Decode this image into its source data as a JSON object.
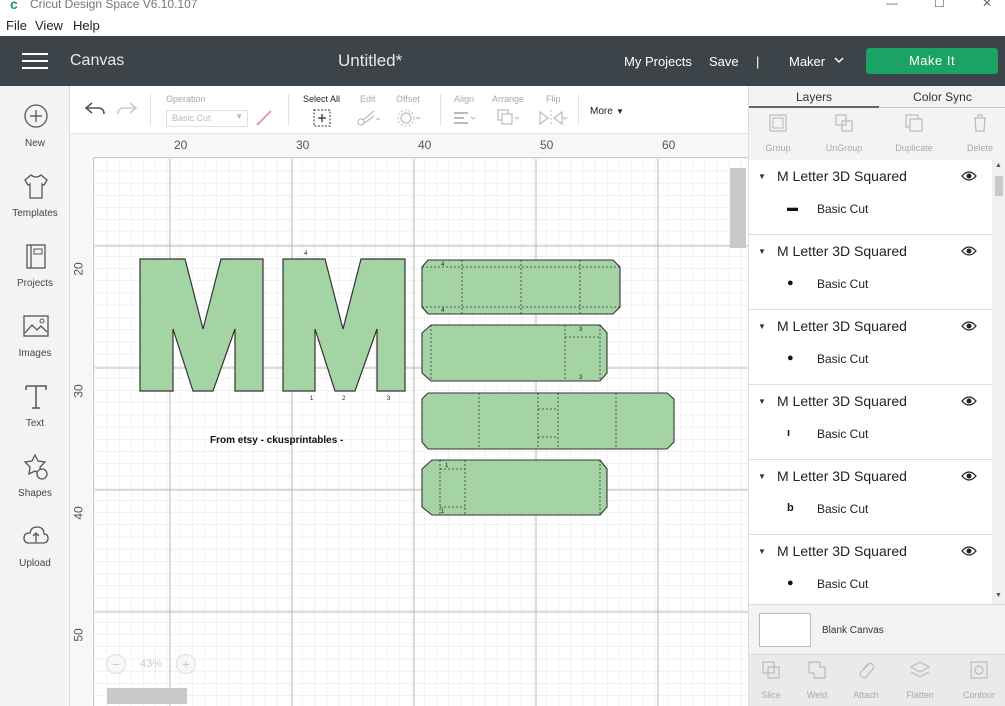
{
  "window": {
    "app_title": "Cricut Design Space  V6.10.107",
    "app_icon_glyph": "c"
  },
  "menu": {
    "items": [
      "File",
      "View",
      "Help"
    ]
  },
  "header": {
    "section": "Canvas",
    "doc_title": "Untitled*",
    "my_projects": "My Projects",
    "save": "Save",
    "separator": "|",
    "machine": "Maker",
    "make_it": "Make It",
    "accent_color": "#1aa364"
  },
  "sidebar": {
    "items": [
      {
        "label": "New",
        "icon": "plus-circle-icon"
      },
      {
        "label": "Templates",
        "icon": "shirt-icon"
      },
      {
        "label": "Projects",
        "icon": "book-icon"
      },
      {
        "label": "Images",
        "icon": "image-icon"
      },
      {
        "label": "Text",
        "icon": "text-icon"
      },
      {
        "label": "Shapes",
        "icon": "shapes-icon"
      },
      {
        "label": "Upload",
        "icon": "upload-cloud-icon"
      }
    ]
  },
  "toolbar": {
    "operation_label": "Operation",
    "operation_value": "Basic Cut",
    "select_all": "Select All",
    "edit": "Edit",
    "offset": "Offset",
    "align": "Align",
    "arrange": "Arrange",
    "flip": "Flip",
    "more": "More"
  },
  "canvas": {
    "ruler_top": [
      "20",
      "30",
      "40",
      "50",
      "60"
    ],
    "ruler_left": [
      "20",
      "30",
      "40",
      "50"
    ],
    "design_text": "From etsy - ckusprintables -",
    "letter": "M",
    "fill_color": "#a4d4a4",
    "zoom_level": "43%",
    "small_labels": [
      "4",
      "4",
      "4",
      "1",
      "2",
      "3",
      "3",
      "3",
      "1",
      "1"
    ]
  },
  "layers_panel": {
    "tabs": [
      "Layers",
      "Color Sync"
    ],
    "tools": [
      "Group",
      "UnGroup",
      "Duplicate",
      "Delete"
    ],
    "groups": [
      {
        "name": "M Letter 3D Squared",
        "layer": "Basic Cut",
        "thumb": "▬"
      },
      {
        "name": "M Letter 3D Squared",
        "layer": "Basic Cut",
        "thumb": "●"
      },
      {
        "name": "M Letter 3D Squared",
        "layer": "Basic Cut",
        "thumb": "●"
      },
      {
        "name": "M Letter 3D Squared",
        "layer": "Basic Cut",
        "thumb": "ı"
      },
      {
        "name": "M Letter 3D Squared",
        "layer": "Basic Cut",
        "thumb": "b"
      },
      {
        "name": "M Letter 3D Squared",
        "layer": "Basic Cut",
        "thumb": "●"
      }
    ],
    "blank_canvas": "Blank Canvas",
    "bottom_tools": [
      "Slice",
      "Weld",
      "Attach",
      "Flatten",
      "Contour"
    ]
  }
}
